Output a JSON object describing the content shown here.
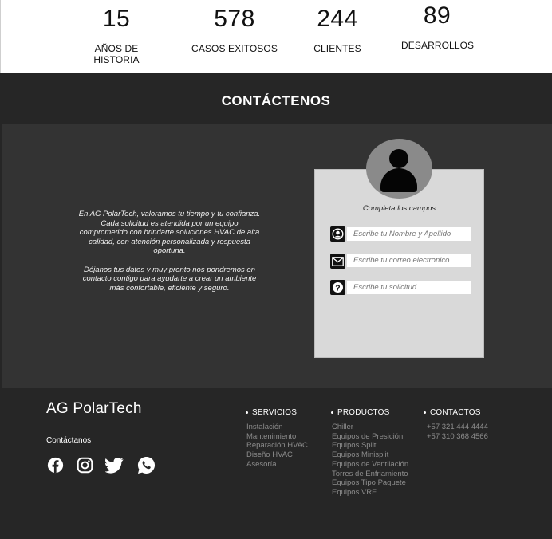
{
  "stats": [
    {
      "number": "15",
      "label": "AÑOS DE HISTORIA"
    },
    {
      "number": "578",
      "label": "CASOS EXITOSOS"
    },
    {
      "number": "244",
      "label": "CLIENTES"
    },
    {
      "number": "89",
      "label": "DESARROLLOS"
    }
  ],
  "contact": {
    "title": "CONTÁCTENOS",
    "paragraph1": "En AG PolarTech, valoramos tu tiempo y tu confianza. Cada solicitud es atendida por un equipo comprometido con brindarte soluciones HVAC de alta calidad, con atención personalizada y respuesta oportuna.",
    "paragraph2": "Déjanos tus datos y muy pronto nos pondremos en contacto contigo para ayudarte a crear un ambiente más confortable, eficiente y seguro.",
    "form": {
      "subtitle": "Completa los campos",
      "name_placeholder": "Escribe tu Nombre y Apellido",
      "email_placeholder": "Escribe tu correo electronico",
      "request_placeholder": "Escribe tu solicitud"
    }
  },
  "footer": {
    "brand": "AG PolarTech",
    "contact_label": "Contáctanos",
    "social_icons": [
      "facebook-icon",
      "instagram-icon",
      "twitter-icon",
      "whatsapp-icon"
    ],
    "columns": {
      "services": {
        "heading": "SERVICIOS",
        "items": [
          "Instalación",
          "Mantenimiento",
          "Reparación HVAC",
          "Diseño HVAC",
          "Asesoría"
        ]
      },
      "products": {
        "heading": "PRODUCTOS",
        "items": [
          "Chiller",
          "Equipos de Presición",
          "Equipos Split",
          "Equipos Minisplit",
          "Equipos de Ventilación",
          "Torres de Enfriamiento",
          "Equipos Tipo Paquete",
          "Equipos VRF"
        ]
      },
      "contacts": {
        "heading": "CONTACTOS",
        "items": [
          "+57 321 444 4444",
          "+57 310 368 4566"
        ]
      }
    }
  },
  "colors": {
    "page_background": "#262626",
    "contact_panel": "#333333",
    "form_card": "#d9d9d9",
    "footer_link": "#8c8c8c"
  }
}
